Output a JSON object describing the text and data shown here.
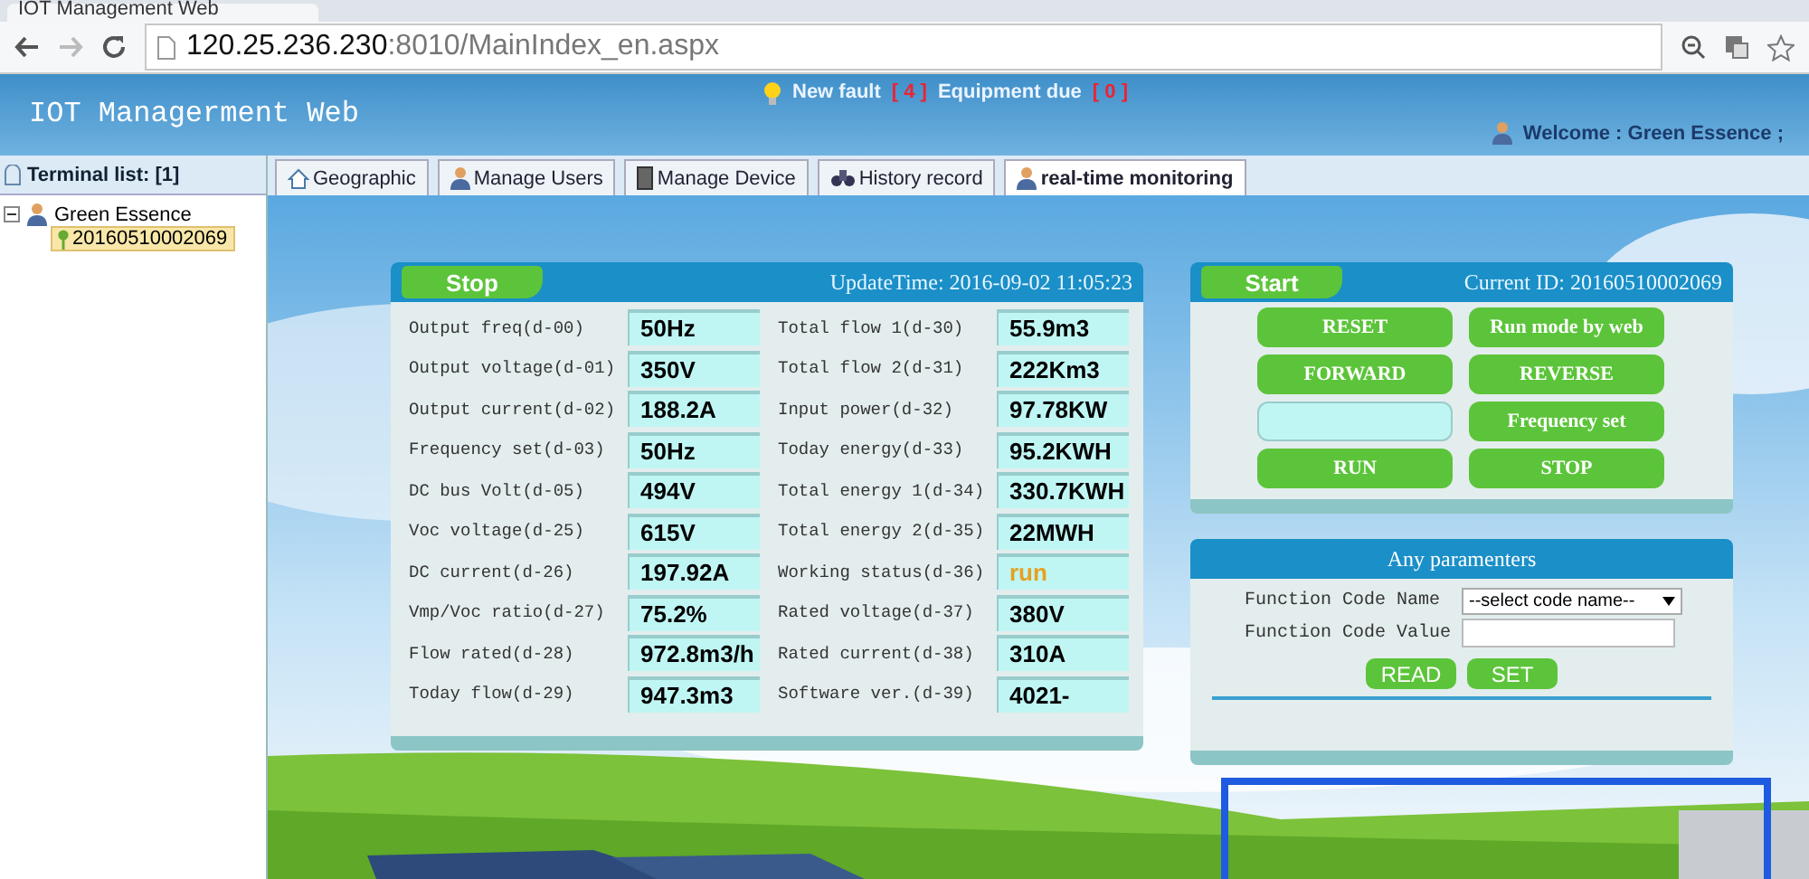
{
  "browser": {
    "tab_title": "IOT Management Web",
    "url_host": "120.25.236.230",
    "url_rest": ":8010/MainIndex_en.aspx"
  },
  "header": {
    "title": "IOT Managerment Web",
    "fault_label": "New fault",
    "fault_count": "[ 4 ]",
    "due_label": "Equipment due",
    "due_count": "[ 0 ]",
    "welcome": "Welcome : Green Essence ;"
  },
  "sidebar": {
    "title": "Terminal list: [1]",
    "tree": [
      {
        "label": "Green Essence",
        "expanded": true,
        "children": [
          {
            "label": "20160510002069",
            "selected": true
          }
        ]
      }
    ]
  },
  "tabs": [
    {
      "label": "Geographic",
      "kind": "house",
      "selected": false
    },
    {
      "label": "Manage Users",
      "kind": "user",
      "selected": false
    },
    {
      "label": "Manage Device",
      "kind": "device",
      "selected": false
    },
    {
      "label": "History record",
      "kind": "binoculars",
      "selected": false
    },
    {
      "label": "real-time monitoring",
      "kind": "user",
      "selected": true
    }
  ],
  "status_panel": {
    "button": "Stop",
    "update_time": "UpdateTime: 2016-09-02 11:05:23",
    "left": [
      {
        "label": "Output freq(d-00)",
        "value": "50Hz",
        "color": "#000000"
      },
      {
        "label": "Output voltage(d-01)",
        "value": "350V",
        "color": "#000000"
      },
      {
        "label": "Output current(d-02)",
        "value": "188.2A",
        "color": "#000000"
      },
      {
        "label": "Frequency set(d-03)",
        "value": "50Hz",
        "color": "#000000"
      },
      {
        "label": "DC bus Volt(d-05)",
        "value": "494V",
        "color": "#000000"
      },
      {
        "label": "Voc voltage(d-25)",
        "value": "615V",
        "color": "#000000"
      },
      {
        "label": "DC current(d-26)",
        "value": "197.92A",
        "color": "#000000"
      },
      {
        "label": "Vmp/Voc ratio(d-27)",
        "value": "75.2%",
        "color": "#000000"
      },
      {
        "label": "Flow rated(d-28)",
        "value": "972.8m3/h",
        "color": "#000000"
      },
      {
        "label": "Today flow(d-29)",
        "value": "947.3m3",
        "color": "#000000"
      }
    ],
    "right": [
      {
        "label": "Total flow 1(d-30)",
        "value": "55.9m3",
        "color": "#000000"
      },
      {
        "label": "Total flow 2(d-31)",
        "value": "222Km3",
        "color": "#000000"
      },
      {
        "label": "Input power(d-32)",
        "value": "97.78KW",
        "color": "#000000"
      },
      {
        "label": "Today energy(d-33)",
        "value": "95.2KWH",
        "color": "#000000"
      },
      {
        "label": "Total energy 1(d-34)",
        "value": "330.7KWH",
        "color": "#000000"
      },
      {
        "label": "Total energy 2(d-35)",
        "value": "22MWH",
        "color": "#000000"
      },
      {
        "label": "Working status(d-36)",
        "value": "run",
        "color": "#e8a020"
      },
      {
        "label": "Rated voltage(d-37)",
        "value": "380V",
        "color": "#000000"
      },
      {
        "label": "Rated current(d-38)",
        "value": "310A",
        "color": "#000000"
      },
      {
        "label": "Software ver.(d-39)",
        "value": "4021-",
        "color": "#000000"
      }
    ]
  },
  "control_panel": {
    "button": "Start",
    "current_id": "Current ID: 20160510002069",
    "controls": [
      {
        "kind": "button",
        "label": "RESET"
      },
      {
        "kind": "button",
        "label": "Run mode by web"
      },
      {
        "kind": "button",
        "label": "FORWARD"
      },
      {
        "kind": "button",
        "label": "REVERSE"
      },
      {
        "kind": "field"
      },
      {
        "kind": "button",
        "label": "Frequency set"
      },
      {
        "kind": "button",
        "label": "RUN"
      },
      {
        "kind": "button",
        "label": "STOP"
      }
    ]
  },
  "params_panel": {
    "title": "Any paramenters",
    "name_label": "Function Code Name",
    "select_value": "--select code name--",
    "value_label": "Function Code Value",
    "buttons": [
      "READ",
      "SET"
    ]
  }
}
